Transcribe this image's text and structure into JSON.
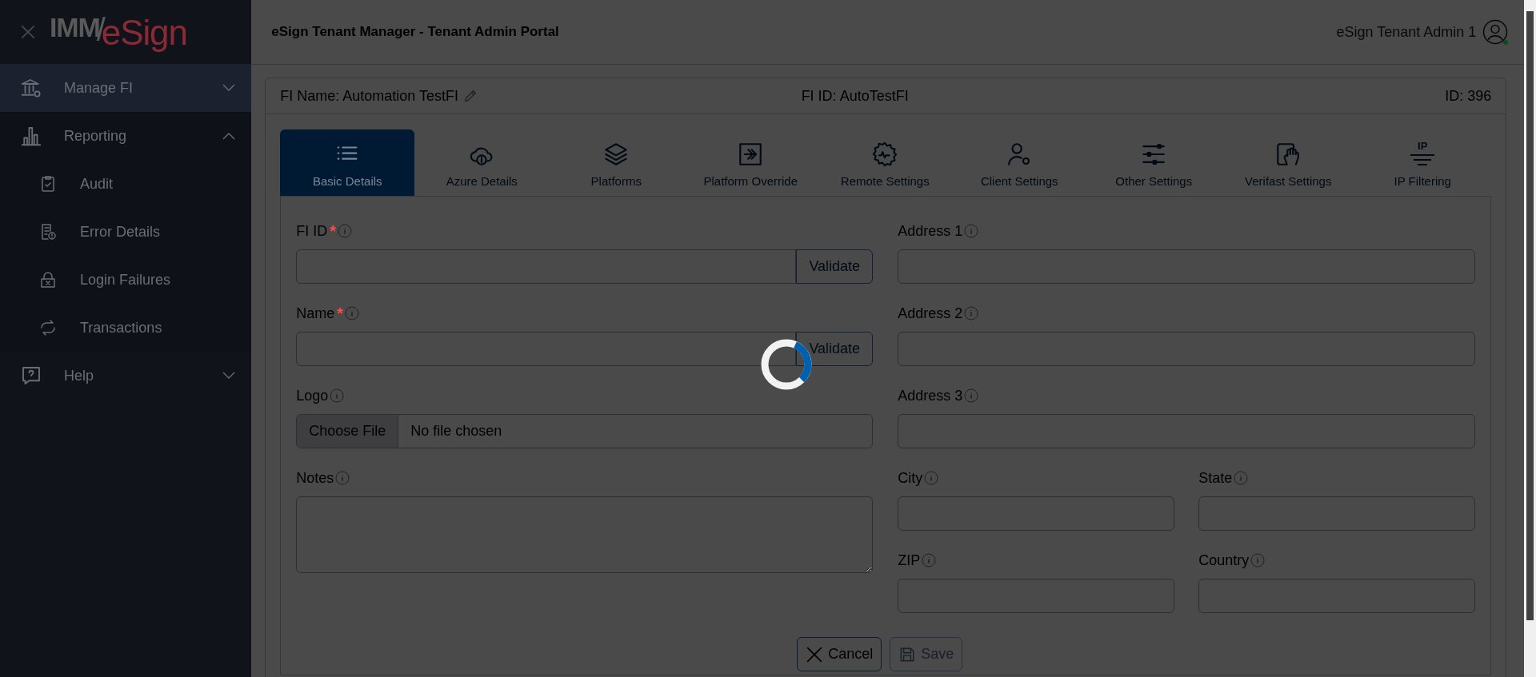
{
  "sidebar": {
    "logo": {
      "left": "IMM",
      "separator": "/",
      "right": "eSign"
    },
    "items": [
      {
        "label": "Manage FI",
        "selected": true,
        "expanded": false
      },
      {
        "label": "Reporting",
        "selected": false,
        "expanded": true,
        "children": [
          {
            "label": "Audit"
          },
          {
            "label": "Error Details"
          },
          {
            "label": "Login Failures"
          },
          {
            "label": "Transactions"
          }
        ]
      },
      {
        "label": "Help",
        "selected": false,
        "expanded": false
      }
    ]
  },
  "header": {
    "title": "eSign Tenant Manager - Tenant Admin Portal",
    "user": "eSign Tenant Admin 1",
    "online": true
  },
  "fi_bar": {
    "name": "FI Name: Automation TestFI",
    "fi_id": "FI ID: AutoTestFI",
    "id": "ID: 396"
  },
  "tabs": [
    {
      "label": "Basic Details",
      "selected": true
    },
    {
      "label": "Azure Details",
      "selected": false
    },
    {
      "label": "Platforms",
      "selected": false
    },
    {
      "label": "Platform Override",
      "selected": false
    },
    {
      "label": "Remote Settings",
      "selected": false
    },
    {
      "label": "Client Settings",
      "selected": false
    },
    {
      "label": "Other Settings",
      "selected": false
    },
    {
      "label": "Verifast Settings",
      "selected": false
    },
    {
      "label": "IP Filtering",
      "selected": false,
      "badge": "IP"
    }
  ],
  "left_fields": [
    {
      "label": "FI ID",
      "required_mark": "*",
      "kind": "validate",
      "button": "Validate"
    },
    {
      "label": "Name",
      "required_mark": "*",
      "kind": "validate",
      "button": "Validate"
    },
    {
      "label": "Logo",
      "kind": "file",
      "button": "Choose File",
      "value": "No file chosen"
    },
    {
      "label": "Notes",
      "kind": "textarea"
    }
  ],
  "right_fields": [
    {
      "label": "Address 1",
      "kind": "wide"
    },
    {
      "label": "Address 2",
      "kind": "wide"
    },
    {
      "label": "Address 3",
      "kind": "wide"
    },
    {
      "label": "City",
      "kind": "half"
    },
    {
      "label": "State",
      "kind": "half"
    },
    {
      "label": "ZIP",
      "kind": "half"
    },
    {
      "label": "Country",
      "kind": "half"
    }
  ],
  "actions": [
    {
      "label": "Cancel",
      "kind": "cancel",
      "disabled": false
    },
    {
      "label": "Save",
      "kind": "save",
      "disabled": true
    }
  ],
  "loading": true
}
